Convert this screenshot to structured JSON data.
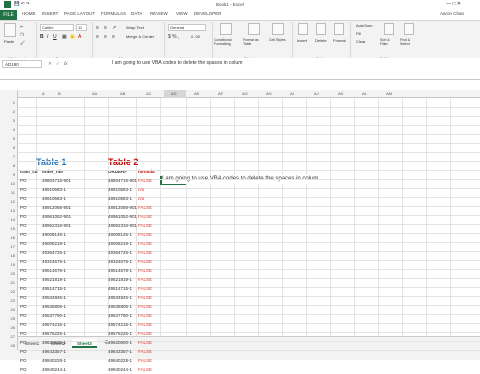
{
  "window": {
    "title": "Book1 - Excel",
    "user": "Aaron Chan"
  },
  "ribbon_tabs": [
    "FILE",
    "HOME",
    "INSERT",
    "PAGE LAYOUT",
    "FORMULAS",
    "DATA",
    "REVIEW",
    "VIEW",
    "DEVELOPER"
  ],
  "ribbon": {
    "font_name": "Calibri",
    "font_size": "11",
    "paste_label": "Paste",
    "wrap_text": "Wrap Text",
    "merge_center": "Merge & Center",
    "number_format": "General",
    "conditional_formatting": "Conditional Formatting",
    "format_as_table": "Format as Table",
    "cell_styles": "Cell Styles",
    "insert": "Insert",
    "delete": "Delete",
    "format": "Format",
    "autosum": "AutoSum",
    "fill": "Fill",
    "clear": "Clear",
    "sort_filter": "Sort & Filter",
    "find_select": "Find & Select",
    "groups": [
      "Clipboard",
      "Font",
      "Alignment",
      "Number",
      "Styles",
      "Cells",
      "Editing"
    ]
  },
  "formula_bar": {
    "name_box": "AD190",
    "fx": "fx",
    "content": "I am going to use VBA codes to delete the spaces in colum"
  },
  "columns": [
    "A",
    "B",
    "AA",
    "AB",
    "AC",
    "AD",
    "AE",
    "AF",
    "AG",
    "AH",
    "AI",
    "AJ",
    "AK",
    "AL",
    "AM"
  ],
  "row_numbers": [
    "1",
    "2",
    "3",
    "4",
    "5",
    "6",
    "7",
    "8",
    "9",
    "10",
    "11",
    "12",
    "13",
    "14",
    "15",
    "16",
    "17",
    "18",
    "19",
    "20",
    "21",
    "22",
    "23",
    "24",
    "25",
    "26",
    "27",
    "28"
  ],
  "table1": {
    "title": "Table 1",
    "headers": [
      "tram_cd",
      "order_nbr"
    ],
    "rows": [
      [
        "PO",
        "48804715-901"
      ],
      [
        "PO",
        "48910583-1"
      ],
      [
        "PO",
        "48910583-1"
      ],
      [
        "PO",
        "48912068-901"
      ],
      [
        "PO",
        "48961052-901"
      ],
      [
        "PO",
        "48962316-901"
      ],
      [
        "PO",
        "49008145-1"
      ],
      [
        "PO",
        "49008219-1"
      ],
      [
        "PO",
        "49364725-1"
      ],
      [
        "PO",
        "49324675-1"
      ],
      [
        "PO",
        "49514678-1"
      ],
      [
        "PO",
        "49521819-1"
      ],
      [
        "PO",
        "49514715-1"
      ],
      [
        "PO",
        "49534845-1"
      ],
      [
        "PO",
        "49536806-1"
      ],
      [
        "PO",
        "49537790-1"
      ],
      [
        "PO",
        "49574215-1"
      ],
      [
        "PO",
        "49576225-1"
      ],
      [
        "PO",
        "49620600-1"
      ],
      [
        "PO",
        "49643357-1"
      ],
      [
        "PO",
        "49940228-1"
      ],
      [
        "PO",
        "49940244-1"
      ]
    ]
  },
  "table2": {
    "title": "Table 2",
    "headers": [
      "ORDER#",
      "formula"
    ],
    "rows": [
      [
        "48804715-901",
        "FALSE"
      ],
      [
        "48910583-1",
        "n/a"
      ],
      [
        "48910583-1",
        "n/a"
      ],
      [
        "48912068-901",
        "FALSE"
      ],
      [
        "48961052-901",
        "FALSE"
      ],
      [
        "48962316-901",
        "FALSE"
      ],
      [
        "49008145-1",
        "FALSE"
      ],
      [
        "49008219-1",
        "FALSE"
      ],
      [
        "49364725-1",
        "FALSE"
      ],
      [
        "49324675-1",
        "FALSE"
      ],
      [
        "49514678-1",
        "FALSE"
      ],
      [
        "49521819-1",
        "FALSE"
      ],
      [
        "49514715-1",
        "FALSE"
      ],
      [
        "49534845-1",
        "FALSE"
      ],
      [
        "49536806-1",
        "FALSE"
      ],
      [
        "49537790-1",
        "FALSE"
      ],
      [
        "49574215-1",
        "FALSE"
      ],
      [
        "49576225-1",
        "FALSE"
      ],
      [
        "49620600-1",
        "FALSE"
      ],
      [
        "49643357-1",
        "FALSE"
      ],
      [
        "49940228-1",
        "FALSE"
      ],
      [
        "49940244-1",
        "FALSE"
      ]
    ]
  },
  "active_cell_text": "I am going to use VBA codes to delete the spaces in colum",
  "sheets": [
    "Sheet1",
    "Sheet2",
    "Sheet3"
  ],
  "active_sheet": "Sheet3",
  "colors": {
    "excel_green": "#217346",
    "table1_title": "#2e75b6",
    "table2_title": "#c00000",
    "false_text": "#e0403a"
  }
}
